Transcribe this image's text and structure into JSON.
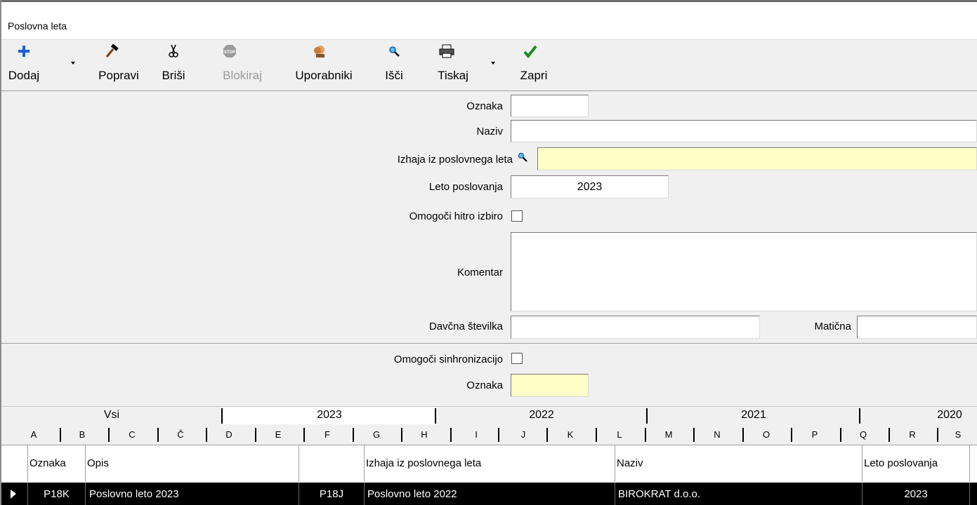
{
  "window": {
    "title": "Poslovna leta"
  },
  "toolbar": {
    "add_label": "Dodaj",
    "edit_label": "Popravi",
    "delete_label": "Briši",
    "block_label": "Blokiraj",
    "users_label": "Uporabniki",
    "search_label": "Išči",
    "print_label": "Tiskaj",
    "close_label": "Zapri"
  },
  "form": {
    "code_label": "Oznaka",
    "code_value": "",
    "name_label": "Naziv",
    "name_value": "",
    "source_year_label": "Izhaja iz poslovnega leta",
    "source_year_value": "",
    "business_year_label": "Leto poslovanja",
    "business_year_value": "2023",
    "quick_select_label": "Omogoči hitro izbiro",
    "quick_select_checked": false,
    "comment_label": "Komentar",
    "comment_value": "",
    "tax_number_label": "Davčna številka",
    "tax_number_value": "",
    "registration_label": "Matična",
    "registration_value": "",
    "sync_label": "Omogoči sinhronizacijo",
    "sync_checked": false,
    "sync_code_label": "Oznaka",
    "sync_code_value": ""
  },
  "year_tabs": [
    "Vsi",
    "2023",
    "2022",
    "2021",
    "2020"
  ],
  "letter_tabs": [
    "A",
    "B",
    "C",
    "Č",
    "D",
    "E",
    "F",
    "G",
    "H",
    "I",
    "J",
    "K",
    "L",
    "M",
    "N",
    "O",
    "P",
    "Q",
    "R",
    "S"
  ],
  "grid": {
    "headers": [
      "Oznaka",
      "Opis",
      "",
      "Izhaja iz poslovnega leta",
      "Naziv",
      "Leto poslovanja"
    ],
    "rows": [
      {
        "oznaka": "P18K",
        "opis": "Poslovno leto 2023",
        "izhaja_oznaka": "P18J",
        "izhaja_opis": "Poslovno leto 2022",
        "naziv": "BIROKRAT d.o.o.",
        "leto": "2023"
      }
    ]
  },
  "colors": {
    "input_yellow": "#ffffc8",
    "selected_row": "#000000",
    "disabled_text": "#9b9b9b"
  }
}
